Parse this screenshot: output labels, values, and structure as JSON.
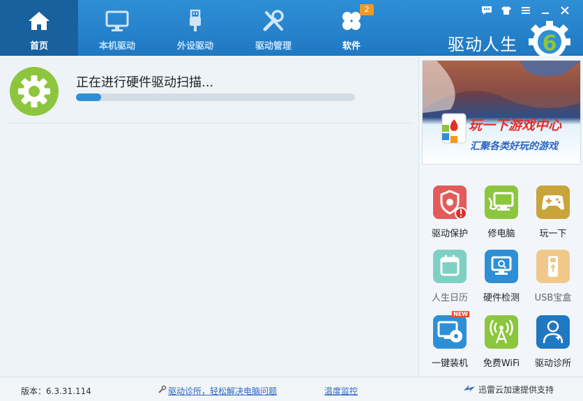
{
  "nav": {
    "items": [
      {
        "label": "首页",
        "icon": "home-icon",
        "active": true
      },
      {
        "label": "本机驱动",
        "icon": "monitor-icon",
        "active": false
      },
      {
        "label": "外设驱动",
        "icon": "usb-plug-icon",
        "active": false
      },
      {
        "label": "驱动管理",
        "icon": "tools-icon",
        "active": false
      },
      {
        "label": "软件",
        "icon": "clover-icon",
        "active": false
      }
    ],
    "software_badge": "2"
  },
  "window_controls": [
    "message-icon",
    "skin-icon",
    "menu-icon",
    "minimize-icon",
    "close-icon"
  ],
  "brand": {
    "name": "驱动人生",
    "logo": "gear-6-logo"
  },
  "scan": {
    "status_text": "正在进行硬件驱动扫描...",
    "progress": 0.09
  },
  "banner": {
    "title": "玩一下游戏中心",
    "subtitle": "汇聚各类好玩的游戏"
  },
  "tools": [
    {
      "label": "驱动保护",
      "icon": "shield-gear-icon",
      "color": "#e45b5b"
    },
    {
      "label": "修电脑",
      "icon": "repair-monitor-icon",
      "color": "#8cc63e"
    },
    {
      "label": "玩一下",
      "icon": "gamepad-icon",
      "color": "#c9a43a"
    },
    {
      "label": "人生日历",
      "icon": "calendar-icon",
      "color": "#7fd0c4",
      "dim": true
    },
    {
      "label": "硬件检测",
      "icon": "hardware-check-icon",
      "color": "#2f8fd6"
    },
    {
      "label": "USB宝盒",
      "icon": "usb-box-icon",
      "color": "#f0c98a",
      "dim": true
    },
    {
      "label": "一键装机",
      "icon": "install-disc-icon",
      "color": "#2f8fd6",
      "tag": "NEW"
    },
    {
      "label": "免费WiFi",
      "icon": "wifi-tower-icon",
      "color": "#8cc63e"
    },
    {
      "label": "驱动诊所",
      "icon": "doctor-icon",
      "color": "#1f78c2"
    }
  ],
  "status": {
    "version": "版本：6.3.31.114",
    "clinic_link": "驱动诊所，轻松解决电脑问题",
    "temp_link": "温度监控",
    "thunder": "迅雷云加速提供支持"
  }
}
